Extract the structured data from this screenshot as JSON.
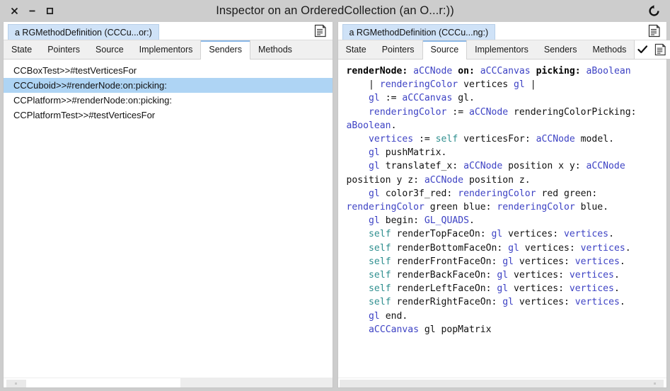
{
  "window": {
    "title": "Inspector on an OrderedCollection (an O...r:))",
    "controls": [
      {
        "name": "close-button",
        "glyph": "×"
      },
      {
        "name": "minimize-button",
        "glyph": "−"
      },
      {
        "name": "maximize-button",
        "glyph": "□"
      }
    ],
    "refresh_icon": "refresh-icon"
  },
  "left_pane": {
    "object_tab": "a RGMethodDefinition (CCCu...or:)",
    "header_icon": "document-icon",
    "tabs": [
      {
        "label": "State",
        "selected": false
      },
      {
        "label": "Pointers",
        "selected": false
      },
      {
        "label": "Source",
        "selected": false
      },
      {
        "label": "Implementors",
        "selected": false
      },
      {
        "label": "Senders",
        "selected": true
      },
      {
        "label": "Methods",
        "selected": false
      }
    ],
    "list": [
      {
        "text": "CCBoxTest>>#testVerticesFor",
        "selected": false
      },
      {
        "text": "CCCuboid>>#renderNode:on:picking:",
        "selected": true
      },
      {
        "text": "CCPlatform>>#renderNode:on:picking:",
        "selected": false
      },
      {
        "text": "CCPlatformTest>>#testVerticesFor",
        "selected": false
      }
    ]
  },
  "right_pane": {
    "object_tab": "a RGMethodDefinition (CCCu...ng:)",
    "header_icon": "document-icon",
    "tabs": [
      {
        "label": "State",
        "selected": false
      },
      {
        "label": "Pointers",
        "selected": false
      },
      {
        "label": "Source",
        "selected": true
      },
      {
        "label": "Implementors",
        "selected": false
      },
      {
        "label": "Senders",
        "selected": false
      },
      {
        "label": "Methods",
        "selected": false
      }
    ],
    "actions": [
      {
        "name": "accept-checkmark-icon"
      },
      {
        "name": "document-icon"
      }
    ],
    "code_tokens": [
      {
        "t": "renderNode: ",
        "c": "kw"
      },
      {
        "t": "aCCNode",
        "c": "var"
      },
      {
        "t": " ",
        "c": "plain"
      },
      {
        "t": "on: ",
        "c": "kw"
      },
      {
        "t": "aCCCanvas",
        "c": "var"
      },
      {
        "t": " ",
        "c": "plain"
      },
      {
        "t": "picking: ",
        "c": "kw"
      },
      {
        "t": "aBoolean",
        "c": "var"
      },
      {
        "t": "\n    | ",
        "c": "plain"
      },
      {
        "t": "renderingColor",
        "c": "var"
      },
      {
        "t": " vertices ",
        "c": "plain"
      },
      {
        "t": "gl",
        "c": "var"
      },
      {
        "t": " |\n    ",
        "c": "plain"
      },
      {
        "t": "gl",
        "c": "var"
      },
      {
        "t": " := ",
        "c": "plain"
      },
      {
        "t": "aCCCanvas",
        "c": "var"
      },
      {
        "t": " gl.\n    ",
        "c": "plain"
      },
      {
        "t": "renderingColor",
        "c": "var"
      },
      {
        "t": " := ",
        "c": "plain"
      },
      {
        "t": "aCCNode",
        "c": "var"
      },
      {
        "t": " renderingColorPicking: ",
        "c": "plain"
      },
      {
        "t": "aBoolean",
        "c": "var"
      },
      {
        "t": ".\n    ",
        "c": "plain"
      },
      {
        "t": "vertices",
        "c": "var"
      },
      {
        "t": " := ",
        "c": "plain"
      },
      {
        "t": "self",
        "c": "self"
      },
      {
        "t": " verticesFor: ",
        "c": "plain"
      },
      {
        "t": "aCCNode",
        "c": "var"
      },
      {
        "t": " model.\n    ",
        "c": "plain"
      },
      {
        "t": "gl",
        "c": "var"
      },
      {
        "t": " pushMatrix.\n    ",
        "c": "plain"
      },
      {
        "t": "gl",
        "c": "var"
      },
      {
        "t": " translatef_x: ",
        "c": "plain"
      },
      {
        "t": "aCCNode",
        "c": "var"
      },
      {
        "t": " position x y: ",
        "c": "plain"
      },
      {
        "t": "aCCNode",
        "c": "var"
      },
      {
        "t": "\nposition y z: ",
        "c": "plain"
      },
      {
        "t": "aCCNode",
        "c": "var"
      },
      {
        "t": " position z.\n    ",
        "c": "plain"
      },
      {
        "t": "gl",
        "c": "var"
      },
      {
        "t": " color3f_red: ",
        "c": "plain"
      },
      {
        "t": "renderingColor",
        "c": "var"
      },
      {
        "t": " red green:\n",
        "c": "plain"
      },
      {
        "t": "renderingColor",
        "c": "var"
      },
      {
        "t": " green blue: ",
        "c": "plain"
      },
      {
        "t": "renderingColor",
        "c": "var"
      },
      {
        "t": " blue.\n    ",
        "c": "plain"
      },
      {
        "t": "gl",
        "c": "var"
      },
      {
        "t": " begin: ",
        "c": "plain"
      },
      {
        "t": "GL_QUADS",
        "c": "var"
      },
      {
        "t": ".\n    ",
        "c": "plain"
      },
      {
        "t": "self",
        "c": "self"
      },
      {
        "t": " renderTopFaceOn: ",
        "c": "plain"
      },
      {
        "t": "gl",
        "c": "var"
      },
      {
        "t": " vertices: ",
        "c": "plain"
      },
      {
        "t": "vertices",
        "c": "var"
      },
      {
        "t": ".\n    ",
        "c": "plain"
      },
      {
        "t": "self",
        "c": "self"
      },
      {
        "t": " renderBottomFaceOn: ",
        "c": "plain"
      },
      {
        "t": "gl",
        "c": "var"
      },
      {
        "t": " vertices: ",
        "c": "plain"
      },
      {
        "t": "vertices",
        "c": "var"
      },
      {
        "t": ".\n    ",
        "c": "plain"
      },
      {
        "t": "self",
        "c": "self"
      },
      {
        "t": " renderFrontFaceOn: ",
        "c": "plain"
      },
      {
        "t": "gl",
        "c": "var"
      },
      {
        "t": " vertices: ",
        "c": "plain"
      },
      {
        "t": "vertices",
        "c": "var"
      },
      {
        "t": ".\n    ",
        "c": "plain"
      },
      {
        "t": "self",
        "c": "self"
      },
      {
        "t": " renderBackFaceOn: ",
        "c": "plain"
      },
      {
        "t": "gl",
        "c": "var"
      },
      {
        "t": " vertices: ",
        "c": "plain"
      },
      {
        "t": "vertices",
        "c": "var"
      },
      {
        "t": ".\n    ",
        "c": "plain"
      },
      {
        "t": "self",
        "c": "self"
      },
      {
        "t": " renderLeftFaceOn: ",
        "c": "plain"
      },
      {
        "t": "gl",
        "c": "var"
      },
      {
        "t": " vertices: ",
        "c": "plain"
      },
      {
        "t": "vertices",
        "c": "var"
      },
      {
        "t": ".\n    ",
        "c": "plain"
      },
      {
        "t": "self",
        "c": "self"
      },
      {
        "t": " renderRightFaceOn: ",
        "c": "plain"
      },
      {
        "t": "gl",
        "c": "var"
      },
      {
        "t": " vertices: ",
        "c": "plain"
      },
      {
        "t": "vertices",
        "c": "var"
      },
      {
        "t": ".\n    ",
        "c": "plain"
      },
      {
        "t": "gl",
        "c": "var"
      },
      {
        "t": " end.\n    ",
        "c": "plain"
      },
      {
        "t": "aCCCanvas",
        "c": "var"
      },
      {
        "t": " gl popMatrix",
        "c": "plain"
      }
    ]
  },
  "colors": {
    "selection": "#aed4f4",
    "tab_accent": "#8bb8e8",
    "object_tab_bg": "#cfe2f7",
    "variable": "#3d42c4",
    "self_keyword": "#2f8f8f",
    "chrome": "#cdcdcd"
  }
}
